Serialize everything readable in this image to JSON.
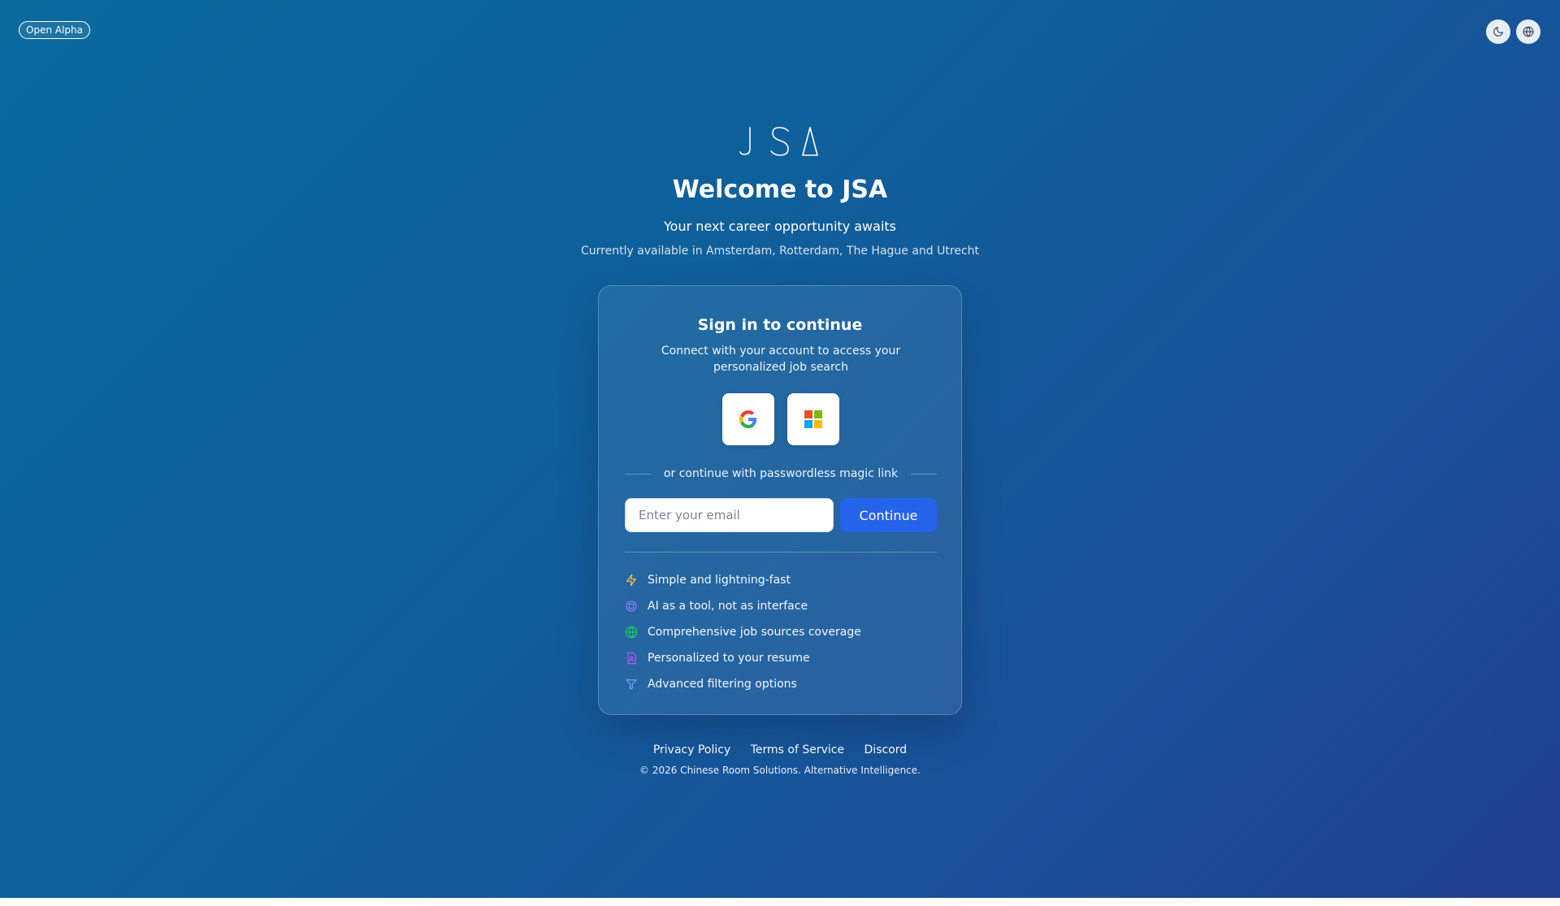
{
  "badge": {
    "label": "Open Alpha"
  },
  "top_controls": {
    "theme_icon": "moon-icon",
    "language_icon": "globe-icon"
  },
  "logo": {
    "text": "JSA"
  },
  "hero": {
    "title": "Welcome to JSA",
    "subtitle": "Your next career opportunity awaits",
    "availability": "Currently available in Amsterdam, Rotterdam, The Hague and Utrecht"
  },
  "card": {
    "title": "Sign in to continue",
    "description": "Connect with your account to access your personalized job search",
    "oauth": [
      {
        "icon": "google-icon"
      },
      {
        "icon": "microsoft-icon"
      }
    ],
    "divider_text": "or continue with passwordless magic link",
    "email": {
      "placeholder": "Enter your email",
      "value": ""
    },
    "continue_label": "Continue",
    "features": [
      {
        "icon": "lightning-icon",
        "label": "Simple and lightning-fast",
        "color": "#f5b83d"
      },
      {
        "icon": "cpu-icon",
        "label": "AI as a tool, not as interface",
        "color": "#8b7cf6"
      },
      {
        "icon": "globe-icon",
        "label": "Comprehensive job sources coverage",
        "color": "#22c55e"
      },
      {
        "icon": "document-user-icon",
        "label": "Personalized to your resume",
        "color": "#a855f7"
      },
      {
        "icon": "filter-icon",
        "label": "Advanced filtering options",
        "color": "#60a5fa"
      }
    ]
  },
  "footer": {
    "links": [
      "Privacy Policy",
      "Terms of Service",
      "Discord"
    ],
    "copyright": "© 2026 Chinese Room Solutions. Alternative Intelligence."
  },
  "colors": {
    "accent": "#2563eb",
    "background_start": "#0a6a9e",
    "background_end": "#213f8f"
  }
}
